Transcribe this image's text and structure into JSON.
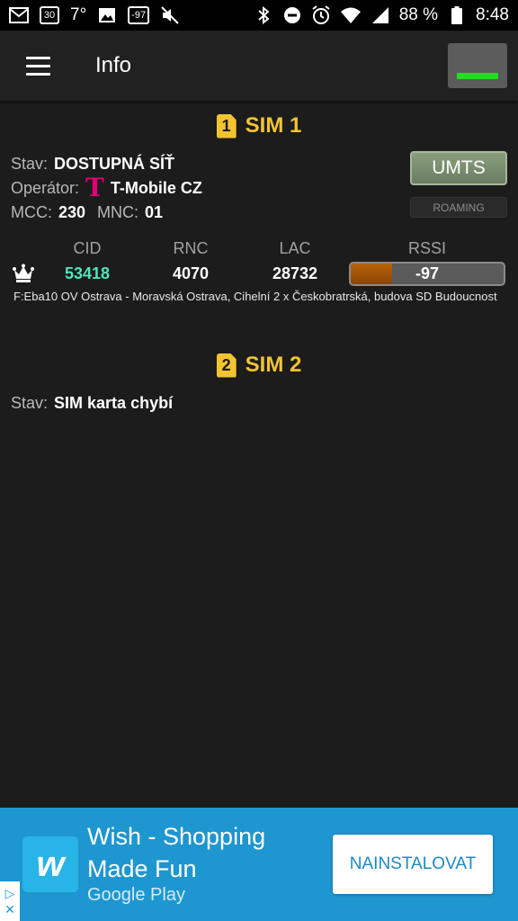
{
  "statusbar": {
    "temperature": "7°",
    "calendar_day": "30",
    "signal_badge": "-97",
    "battery_percent": "88 %",
    "time": "8:48"
  },
  "appbar": {
    "title": "Info",
    "signal_indicator_color": "#22dd22"
  },
  "sim1": {
    "badge": "1",
    "title": "SIM 1",
    "status_label": "Stav:",
    "status_value": "DOSTUPNÁ SÍŤ",
    "operator_label": "Operátor:",
    "operator_logo": "T",
    "operator_value": "T-Mobile CZ",
    "mcc_label": "MCC:",
    "mcc_value": "230",
    "mnc_label": "MNC:",
    "mnc_value": "01",
    "technology": "UMTS",
    "roaming": "ROAMING",
    "cell": {
      "headers": [
        "CID",
        "RNC",
        "LAC",
        "RSSI"
      ],
      "cid": "53418",
      "rnc": "4070",
      "lac": "28732",
      "rssi": "-97",
      "rssi_level": 0.27,
      "location": "F:Eba10 OV Ostrava - Moravská Ostrava, Cihelní 2 x Českobratrská, budova SD Budoucnost"
    }
  },
  "sim2": {
    "badge": "2",
    "title": "SIM 2",
    "status_label": "Stav:",
    "status_value": "SIM karta chybí"
  },
  "ad": {
    "title": "Wish - Shopping Made Fun",
    "store": "Google Play",
    "install_label": "NAINSTALOVAT"
  },
  "colors": {
    "sim_title": "#f4c430",
    "cid_value": "#4ee6b8",
    "accent": "#1e96d0"
  }
}
